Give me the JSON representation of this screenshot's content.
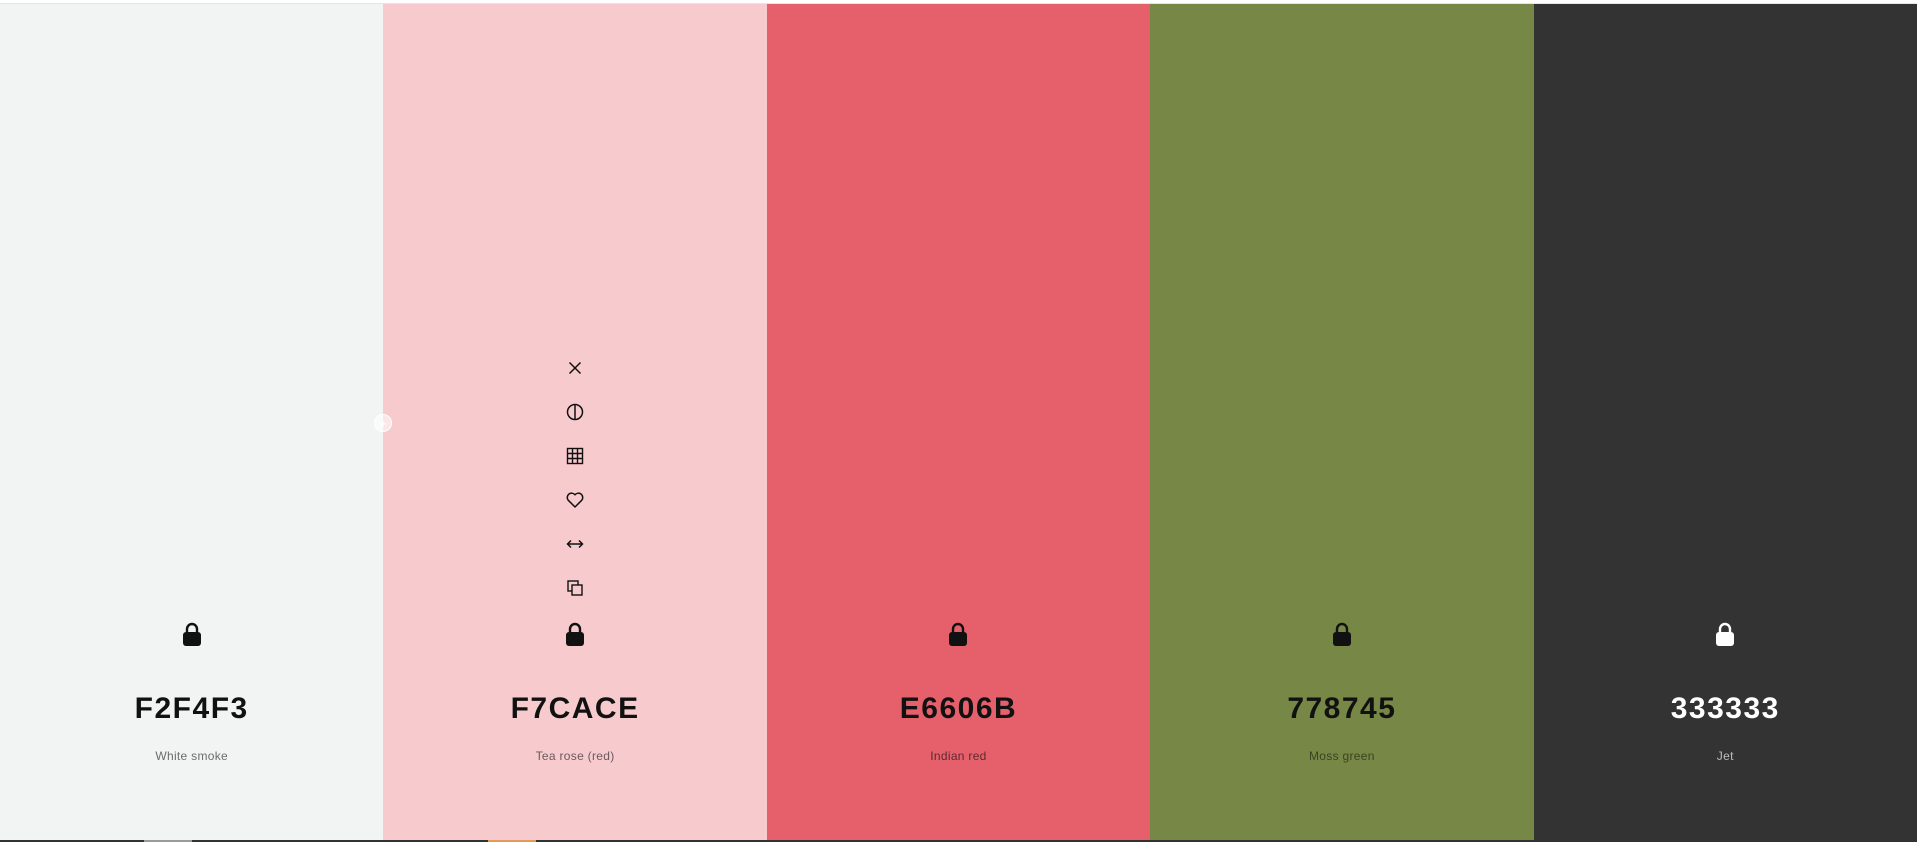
{
  "palette": [
    {
      "hex": "F2F4F3",
      "name": "White smoke",
      "color": "#F2F4F3",
      "text_color": "#111111",
      "name_color": "#6b6d6c",
      "locked": true
    },
    {
      "hex": "F7CACE",
      "name": "Tea rose (red)",
      "color": "#F7CACE",
      "text_color": "#111111",
      "name_color": "#6b5a5c",
      "locked": true
    },
    {
      "hex": "E6606B",
      "name": "Indian red",
      "color": "#E6606B",
      "text_color": "#111111",
      "name_color": "#5c2a2f",
      "locked": true
    },
    {
      "hex": "778745",
      "name": "Moss green",
      "color": "#778745",
      "text_color": "#111111",
      "name_color": "#3a4222",
      "locked": true
    },
    {
      "hex": "333333",
      "name": "Jet",
      "color": "#333333",
      "text_color": "#ffffff",
      "name_color": "#bdbdbd",
      "locked": true
    }
  ],
  "hover_tools": [
    "close-icon",
    "contrast-icon",
    "shades-grid-icon",
    "heart-icon",
    "drag-arrows-icon",
    "copy-icon"
  ],
  "add_color_icon": "+"
}
